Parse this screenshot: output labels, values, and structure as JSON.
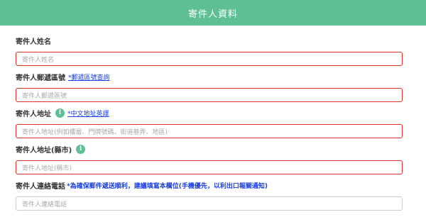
{
  "header": {
    "title": "寄件人資料"
  },
  "fields": [
    {
      "label": "寄件人姓名",
      "placeholder": "寄件人姓名"
    },
    {
      "label": "寄件人郵遞區號",
      "link": "*郵遞區號查詢",
      "placeholder": "寄件人郵遞區號"
    },
    {
      "label": "寄件人地址",
      "link": "*中文地址英譯",
      "placeholder": "寄件人地址(例如樓層、門牌號碼、街道巷弄、地區)"
    },
    {
      "label": "寄件人地址(縣市)",
      "placeholder": "寄件人地址(縣市)"
    },
    {
      "label": "寄件人連絡電話",
      "note": "*為確保郵件遞送順利，建議填寫本欄位(手機優先，以利出口報關通知)",
      "placeholder": "寄件人連絡電話"
    }
  ],
  "colors": {
    "header": "#5dbf93",
    "error_border": "#d9302c",
    "link": "#1b3fd6"
  },
  "icons": {
    "info": "info-icon"
  },
  "info_glyph": "i"
}
